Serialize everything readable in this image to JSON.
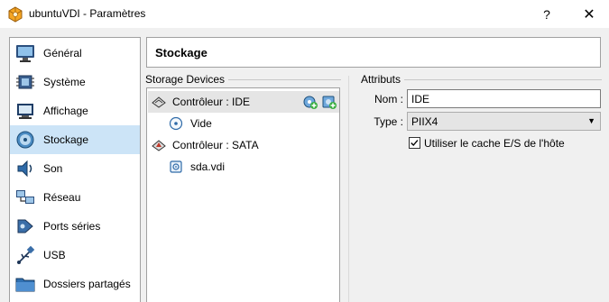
{
  "window": {
    "title": "ubuntuVDI - Paramètres",
    "help_label": "?",
    "close_label": "✕"
  },
  "nav": {
    "items": [
      {
        "label": "Général",
        "icon": "monitor-icon"
      },
      {
        "label": "Système",
        "icon": "chip-icon"
      },
      {
        "label": "Affichage",
        "icon": "display-icon"
      },
      {
        "label": "Stockage",
        "icon": "storage-disk-icon",
        "selected": true
      },
      {
        "label": "Son",
        "icon": "speaker-icon"
      },
      {
        "label": "Réseau",
        "icon": "network-icon"
      },
      {
        "label": "Ports séries",
        "icon": "serial-port-icon"
      },
      {
        "label": "USB",
        "icon": "usb-icon"
      },
      {
        "label": "Dossiers partagés",
        "icon": "shared-folder-icon"
      }
    ]
  },
  "page": {
    "title": "Stockage"
  },
  "storage": {
    "group_label": "Storage Devices",
    "tree": [
      {
        "label": "Contrôleur : IDE",
        "icon": "ide-controller-icon",
        "type": "controller",
        "selected": true
      },
      {
        "label": "Vide",
        "icon": "optical-disc-icon",
        "type": "device"
      },
      {
        "label": "Contrôleur : SATA",
        "icon": "sata-controller-icon",
        "type": "controller"
      },
      {
        "label": "sda.vdi",
        "icon": "hard-disk-icon",
        "type": "device"
      }
    ]
  },
  "attributes": {
    "group_label": "Attributs",
    "name_label": "Nom :",
    "name_value": "IDE",
    "type_label": "Type :",
    "type_value": "PIIX4",
    "cache_label": "Utiliser le cache E/S de l'hôte",
    "cache_checked": true
  },
  "colors": {
    "selected_nav": "#cce4f7",
    "selected_tree": "#e5e5e5",
    "window_bg": "#f0f0f0"
  }
}
